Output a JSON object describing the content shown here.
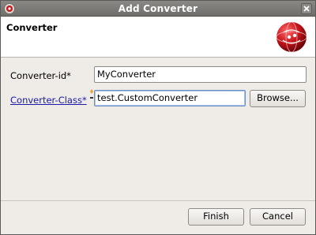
{
  "window": {
    "title": "Add Converter"
  },
  "banner": {
    "title": "Converter",
    "logo_icon": "converter-logo-icon"
  },
  "form": {
    "converter_id": {
      "label": "Converter-id*",
      "value": "MyConverter"
    },
    "converter_class": {
      "label": "Converter-Class*",
      "value": "test.CustomConverter",
      "browse_label": "Browse..."
    }
  },
  "footer": {
    "finish_label": "Finish",
    "cancel_label": "Cancel"
  },
  "colors": {
    "accent_red": "#c8161d",
    "link": "#1a1aa6"
  }
}
